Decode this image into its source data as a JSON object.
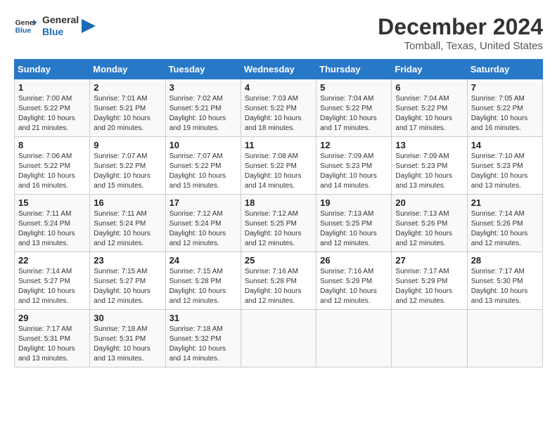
{
  "logo": {
    "text_general": "General",
    "text_blue": "Blue"
  },
  "title": "December 2024",
  "subtitle": "Tomball, Texas, United States",
  "headers": [
    "Sunday",
    "Monday",
    "Tuesday",
    "Wednesday",
    "Thursday",
    "Friday",
    "Saturday"
  ],
  "weeks": [
    [
      {
        "day": "1",
        "sunrise": "Sunrise: 7:00 AM",
        "sunset": "Sunset: 5:22 PM",
        "daylight": "Daylight: 10 hours and 21 minutes."
      },
      {
        "day": "2",
        "sunrise": "Sunrise: 7:01 AM",
        "sunset": "Sunset: 5:21 PM",
        "daylight": "Daylight: 10 hours and 20 minutes."
      },
      {
        "day": "3",
        "sunrise": "Sunrise: 7:02 AM",
        "sunset": "Sunset: 5:21 PM",
        "daylight": "Daylight: 10 hours and 19 minutes."
      },
      {
        "day": "4",
        "sunrise": "Sunrise: 7:03 AM",
        "sunset": "Sunset: 5:22 PM",
        "daylight": "Daylight: 10 hours and 18 minutes."
      },
      {
        "day": "5",
        "sunrise": "Sunrise: 7:04 AM",
        "sunset": "Sunset: 5:22 PM",
        "daylight": "Daylight: 10 hours and 17 minutes."
      },
      {
        "day": "6",
        "sunrise": "Sunrise: 7:04 AM",
        "sunset": "Sunset: 5:22 PM",
        "daylight": "Daylight: 10 hours and 17 minutes."
      },
      {
        "day": "7",
        "sunrise": "Sunrise: 7:05 AM",
        "sunset": "Sunset: 5:22 PM",
        "daylight": "Daylight: 10 hours and 16 minutes."
      }
    ],
    [
      {
        "day": "8",
        "sunrise": "Sunrise: 7:06 AM",
        "sunset": "Sunset: 5:22 PM",
        "daylight": "Daylight: 10 hours and 16 minutes."
      },
      {
        "day": "9",
        "sunrise": "Sunrise: 7:07 AM",
        "sunset": "Sunset: 5:22 PM",
        "daylight": "Daylight: 10 hours and 15 minutes."
      },
      {
        "day": "10",
        "sunrise": "Sunrise: 7:07 AM",
        "sunset": "Sunset: 5:22 PM",
        "daylight": "Daylight: 10 hours and 15 minutes."
      },
      {
        "day": "11",
        "sunrise": "Sunrise: 7:08 AM",
        "sunset": "Sunset: 5:22 PM",
        "daylight": "Daylight: 10 hours and 14 minutes."
      },
      {
        "day": "12",
        "sunrise": "Sunrise: 7:09 AM",
        "sunset": "Sunset: 5:23 PM",
        "daylight": "Daylight: 10 hours and 14 minutes."
      },
      {
        "day": "13",
        "sunrise": "Sunrise: 7:09 AM",
        "sunset": "Sunset: 5:23 PM",
        "daylight": "Daylight: 10 hours and 13 minutes."
      },
      {
        "day": "14",
        "sunrise": "Sunrise: 7:10 AM",
        "sunset": "Sunset: 5:23 PM",
        "daylight": "Daylight: 10 hours and 13 minutes."
      }
    ],
    [
      {
        "day": "15",
        "sunrise": "Sunrise: 7:11 AM",
        "sunset": "Sunset: 5:24 PM",
        "daylight": "Daylight: 10 hours and 13 minutes."
      },
      {
        "day": "16",
        "sunrise": "Sunrise: 7:11 AM",
        "sunset": "Sunset: 5:24 PM",
        "daylight": "Daylight: 10 hours and 12 minutes."
      },
      {
        "day": "17",
        "sunrise": "Sunrise: 7:12 AM",
        "sunset": "Sunset: 5:24 PM",
        "daylight": "Daylight: 10 hours and 12 minutes."
      },
      {
        "day": "18",
        "sunrise": "Sunrise: 7:12 AM",
        "sunset": "Sunset: 5:25 PM",
        "daylight": "Daylight: 10 hours and 12 minutes."
      },
      {
        "day": "19",
        "sunrise": "Sunrise: 7:13 AM",
        "sunset": "Sunset: 5:25 PM",
        "daylight": "Daylight: 10 hours and 12 minutes."
      },
      {
        "day": "20",
        "sunrise": "Sunrise: 7:13 AM",
        "sunset": "Sunset: 5:26 PM",
        "daylight": "Daylight: 10 hours and 12 minutes."
      },
      {
        "day": "21",
        "sunrise": "Sunrise: 7:14 AM",
        "sunset": "Sunset: 5:26 PM",
        "daylight": "Daylight: 10 hours and 12 minutes."
      }
    ],
    [
      {
        "day": "22",
        "sunrise": "Sunrise: 7:14 AM",
        "sunset": "Sunset: 5:27 PM",
        "daylight": "Daylight: 10 hours and 12 minutes."
      },
      {
        "day": "23",
        "sunrise": "Sunrise: 7:15 AM",
        "sunset": "Sunset: 5:27 PM",
        "daylight": "Daylight: 10 hours and 12 minutes."
      },
      {
        "day": "24",
        "sunrise": "Sunrise: 7:15 AM",
        "sunset": "Sunset: 5:28 PM",
        "daylight": "Daylight: 10 hours and 12 minutes."
      },
      {
        "day": "25",
        "sunrise": "Sunrise: 7:16 AM",
        "sunset": "Sunset: 5:28 PM",
        "daylight": "Daylight: 10 hours and 12 minutes."
      },
      {
        "day": "26",
        "sunrise": "Sunrise: 7:16 AM",
        "sunset": "Sunset: 5:29 PM",
        "daylight": "Daylight: 10 hours and 12 minutes."
      },
      {
        "day": "27",
        "sunrise": "Sunrise: 7:17 AM",
        "sunset": "Sunset: 5:29 PM",
        "daylight": "Daylight: 10 hours and 12 minutes."
      },
      {
        "day": "28",
        "sunrise": "Sunrise: 7:17 AM",
        "sunset": "Sunset: 5:30 PM",
        "daylight": "Daylight: 10 hours and 13 minutes."
      }
    ],
    [
      {
        "day": "29",
        "sunrise": "Sunrise: 7:17 AM",
        "sunset": "Sunset: 5:31 PM",
        "daylight": "Daylight: 10 hours and 13 minutes."
      },
      {
        "day": "30",
        "sunrise": "Sunrise: 7:18 AM",
        "sunset": "Sunset: 5:31 PM",
        "daylight": "Daylight: 10 hours and 13 minutes."
      },
      {
        "day": "31",
        "sunrise": "Sunrise: 7:18 AM",
        "sunset": "Sunset: 5:32 PM",
        "daylight": "Daylight: 10 hours and 14 minutes."
      },
      null,
      null,
      null,
      null
    ]
  ]
}
